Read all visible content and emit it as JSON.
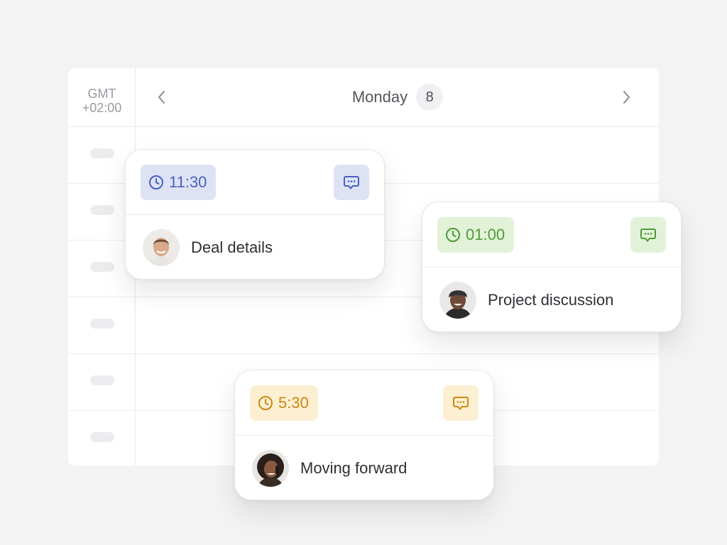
{
  "calendar": {
    "timezone_line1": "GMT",
    "timezone_line2": "+02:00",
    "day_name": "Monday",
    "day_number": "8",
    "prev_icon": "chevron-left-icon",
    "next_icon": "chevron-right-icon"
  },
  "events": [
    {
      "time": "11:30",
      "title": "Deal details",
      "accent": "#4a5fc1",
      "chip_bg": "#dde3f5",
      "clock_icon": "clock-icon",
      "comment_icon": "chat-bubble-icon",
      "avatar": "man-smiling-avatar"
    },
    {
      "time": "01:00",
      "title": "Project discussion",
      "accent": "#4e9a35",
      "chip_bg": "#e1f2d8",
      "clock_icon": "clock-icon",
      "comment_icon": "chat-bubble-icon",
      "avatar": "man-cap-avatar"
    },
    {
      "time": "5:30",
      "title": "Moving forward",
      "accent": "#c88a12",
      "chip_bg": "#fcefd2",
      "clock_icon": "clock-icon",
      "comment_icon": "chat-bubble-icon",
      "avatar": "woman-phone-avatar"
    }
  ]
}
